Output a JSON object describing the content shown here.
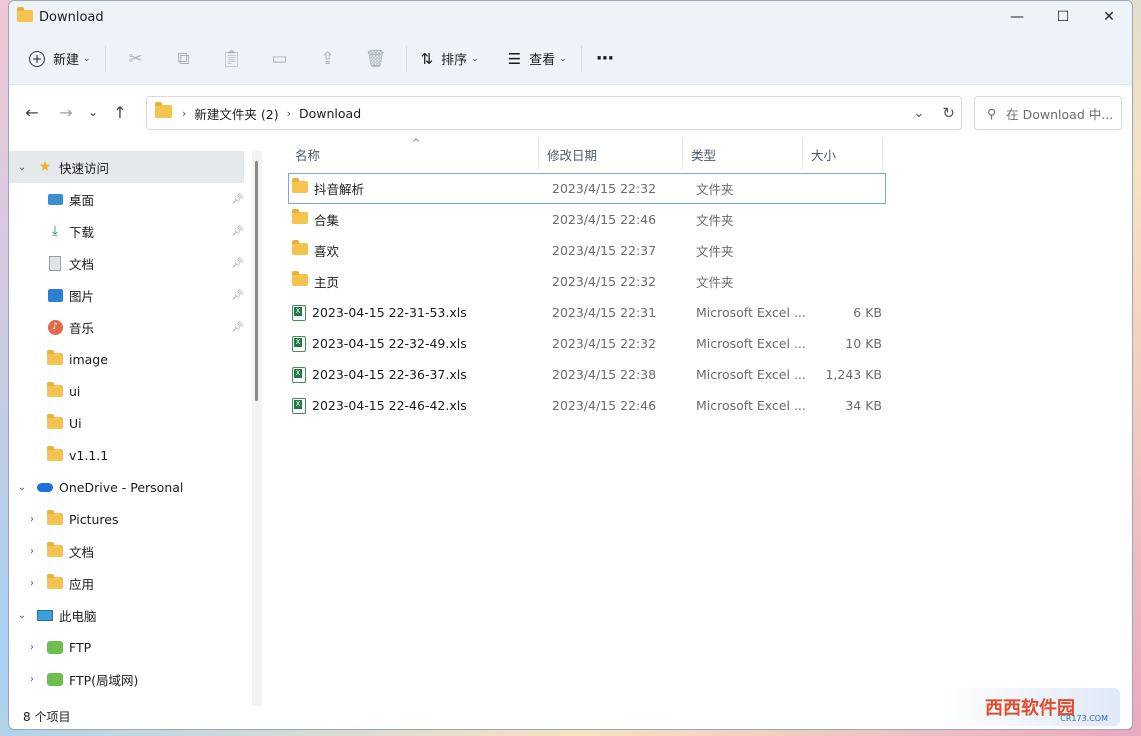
{
  "window": {
    "title": "Download",
    "minimize": "—",
    "maximize": "☐",
    "close": "✕"
  },
  "toolbar": {
    "new_label": "新建",
    "sort_label": "排序",
    "view_label": "查看",
    "more_label": "···"
  },
  "nav": {
    "back": "←",
    "forward": "→",
    "recent": "⌄",
    "up": "↑"
  },
  "address": {
    "crumbs": [
      "新建文件夹 (2)",
      "Download"
    ],
    "dropdown": "⌄",
    "refresh": "↻"
  },
  "search": {
    "placeholder": "在 Download 中..."
  },
  "sidebar": {
    "quick_access": "快速访问",
    "items": [
      {
        "label": "桌面"
      },
      {
        "label": "下载"
      },
      {
        "label": "文档"
      },
      {
        "label": "图片"
      },
      {
        "label": "音乐"
      },
      {
        "label": "image"
      },
      {
        "label": "ui"
      },
      {
        "label": "Ui"
      },
      {
        "label": "v1.1.1"
      }
    ],
    "onedrive": "OneDrive - Personal",
    "onedrive_items": [
      {
        "label": "Pictures"
      },
      {
        "label": "文档"
      },
      {
        "label": "应用"
      }
    ],
    "this_pc": "此电脑",
    "pc_items": [
      {
        "label": "FTP"
      },
      {
        "label": "FTP(局域网)"
      }
    ]
  },
  "columns": {
    "name": "名称",
    "date": "修改日期",
    "type": "类型",
    "size": "大小",
    "sort_indicator": "^"
  },
  "files": [
    {
      "name": "抖音解析",
      "date": "2023/4/15 22:32",
      "type": "文件夹",
      "size": ""
    },
    {
      "name": "合集",
      "date": "2023/4/15 22:46",
      "type": "文件夹",
      "size": ""
    },
    {
      "name": "喜欢",
      "date": "2023/4/15 22:37",
      "type": "文件夹",
      "size": ""
    },
    {
      "name": "主页",
      "date": "2023/4/15 22:32",
      "type": "文件夹",
      "size": ""
    },
    {
      "name": "2023-04-15 22-31-53.xls",
      "date": "2023/4/15 22:31",
      "type": "Microsoft Excel ...",
      "size": "6 KB"
    },
    {
      "name": "2023-04-15 22-32-49.xls",
      "date": "2023/4/15 22:32",
      "type": "Microsoft Excel ...",
      "size": "10 KB"
    },
    {
      "name": "2023-04-15 22-36-37.xls",
      "date": "2023/4/15 22:38",
      "type": "Microsoft Excel ...",
      "size": "1,243 KB"
    },
    {
      "name": "2023-04-15 22-46-42.xls",
      "date": "2023/4/15 22:46",
      "type": "Microsoft Excel ...",
      "size": "34 KB"
    }
  ],
  "status": {
    "count": "8 个项目"
  },
  "watermark": {
    "text": "西西软件园",
    "sub": "CR173.COM"
  }
}
